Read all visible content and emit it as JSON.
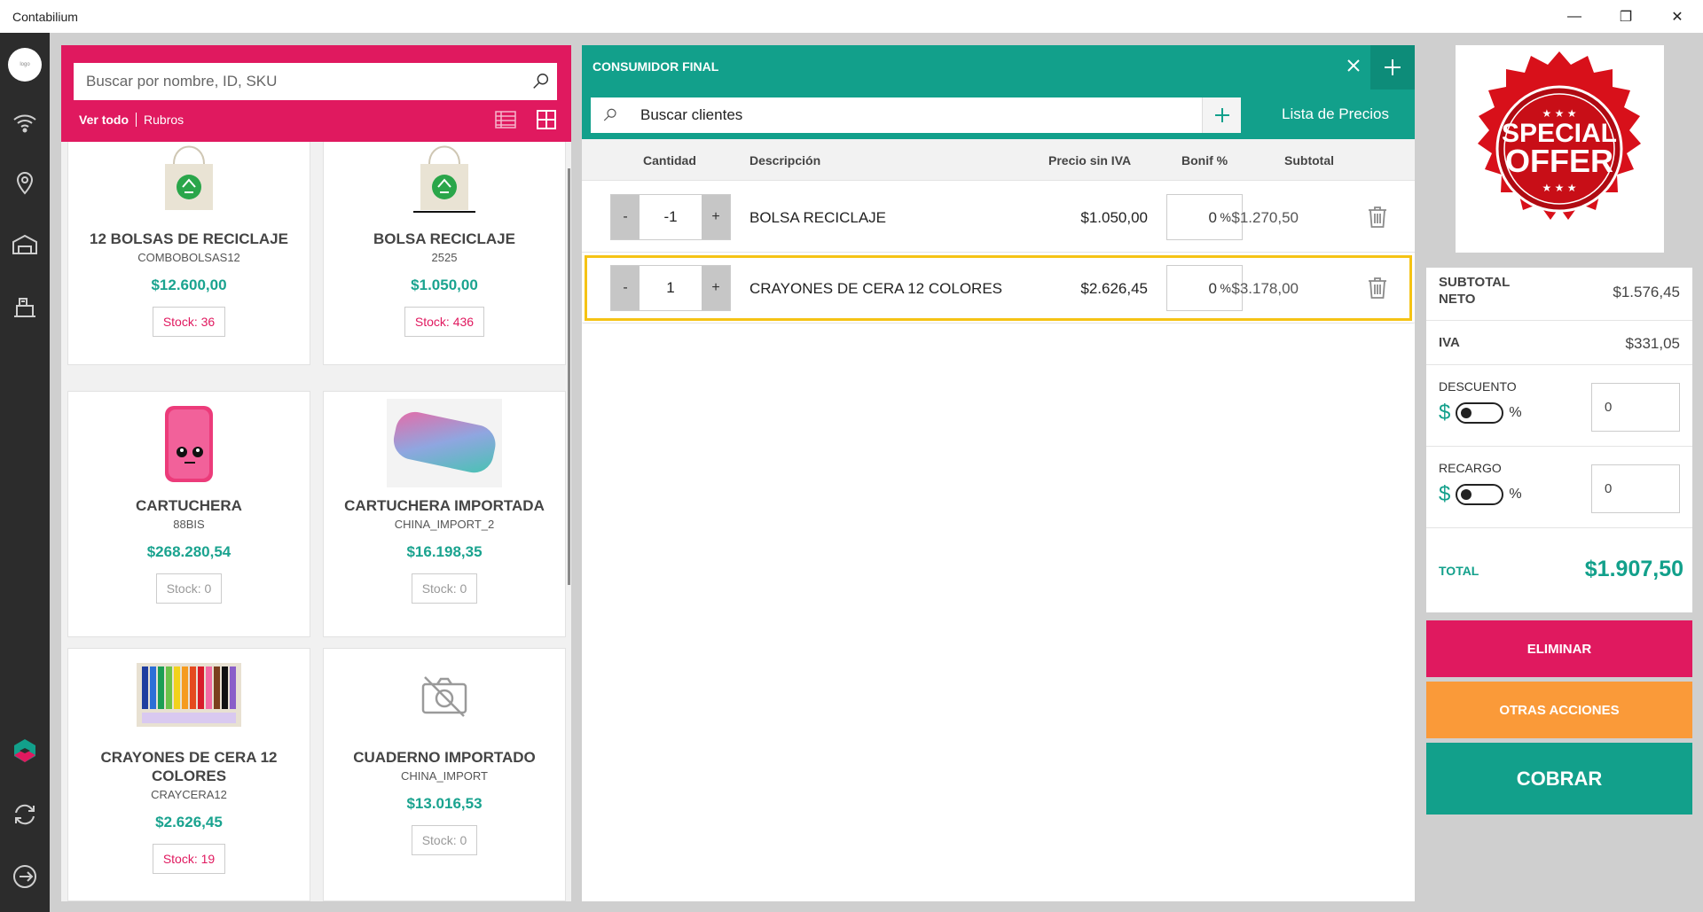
{
  "window": {
    "title": "Contabilium",
    "minimize": "—",
    "maximize": "❐",
    "close": "✕"
  },
  "rail": {
    "avatar_text": "logo"
  },
  "catalog": {
    "search_placeholder": "Buscar por nombre, ID, SKU",
    "filter_all": "Ver todo",
    "filter_categories": "Rubros",
    "products": [
      {
        "name": "12 BOLSAS DE RECICLAJE",
        "sku": "COMBOBOLSAS12",
        "price": "$12.600,00",
        "stock": "Stock: 36",
        "in_stock": true,
        "image": "recycle-bag"
      },
      {
        "name": "BOLSA RECICLAJE",
        "sku": "2525",
        "price": "$1.050,00",
        "stock": "Stock: 436",
        "in_stock": true,
        "image": "recycle-bag"
      },
      {
        "name": "CARTUCHERA",
        "sku": "88BIS",
        "price": "$268.280,54",
        "stock": "Stock: 0",
        "in_stock": false,
        "image": "pink-pencil-case"
      },
      {
        "name": "CARTUCHERA IMPORTADA",
        "sku": "CHINA_IMPORT_2",
        "price": "$16.198,35",
        "stock": "Stock: 0",
        "in_stock": false,
        "image": "gradient-pencil-case"
      },
      {
        "name": "CRAYONES DE CERA 12 COLORES",
        "sku": "CRAYCERA12",
        "price": "$2.626,45",
        "stock": "Stock: 19",
        "in_stock": true,
        "image": "crayons-box"
      },
      {
        "name": "CUADERNO IMPORTADO",
        "sku": "CHINA_IMPORT",
        "price": "$13.016,53",
        "stock": "Stock: 0",
        "in_stock": false,
        "image": "no-image"
      }
    ]
  },
  "order": {
    "customer": "CONSUMIDOR FINAL",
    "client_search_placeholder": "Buscar clientes",
    "price_list": "Lista de Precios",
    "columns": {
      "qty": "Cantidad",
      "desc": "Descripción",
      "price": "Precio sin IVA",
      "discount": "Bonif %",
      "subtotal": "Subtotal"
    },
    "minus": "-",
    "plus": "+",
    "pct": "%",
    "items": [
      {
        "qty": "-1",
        "desc": "BOLSA RECICLAJE",
        "price": "$1.050,00",
        "discount": "0",
        "subtotal": "$1.270,50",
        "selected": false
      },
      {
        "qty": "1",
        "desc": "CRAYONES DE CERA 12 COLORES",
        "price": "$2.626,45",
        "discount": "0",
        "subtotal": "$3.178,00",
        "selected": true
      }
    ]
  },
  "promo": {
    "line1": "SPECIAL",
    "line2": "OFFER"
  },
  "totals": {
    "subtotal_label": "SUBTOTAL NETO",
    "subtotal_value": "$1.576,45",
    "iva_label": "IVA",
    "iva_value": "$331,05",
    "discount_label": "DESCUENTO",
    "discount_value": "0",
    "surcharge_label": "RECARGO",
    "surcharge_value": "0",
    "dollar": "$",
    "pct": "%",
    "total_label": "TOTAL",
    "total_value": "$1.907,50"
  },
  "actions": {
    "delete": "ELIMINAR",
    "other": "OTRAS ACCIONES",
    "pay": "COBRAR"
  },
  "colors": {
    "pink": "#e0195f",
    "teal": "#12a08b",
    "orange": "#fa9a39",
    "highlight": "#f5c314"
  }
}
